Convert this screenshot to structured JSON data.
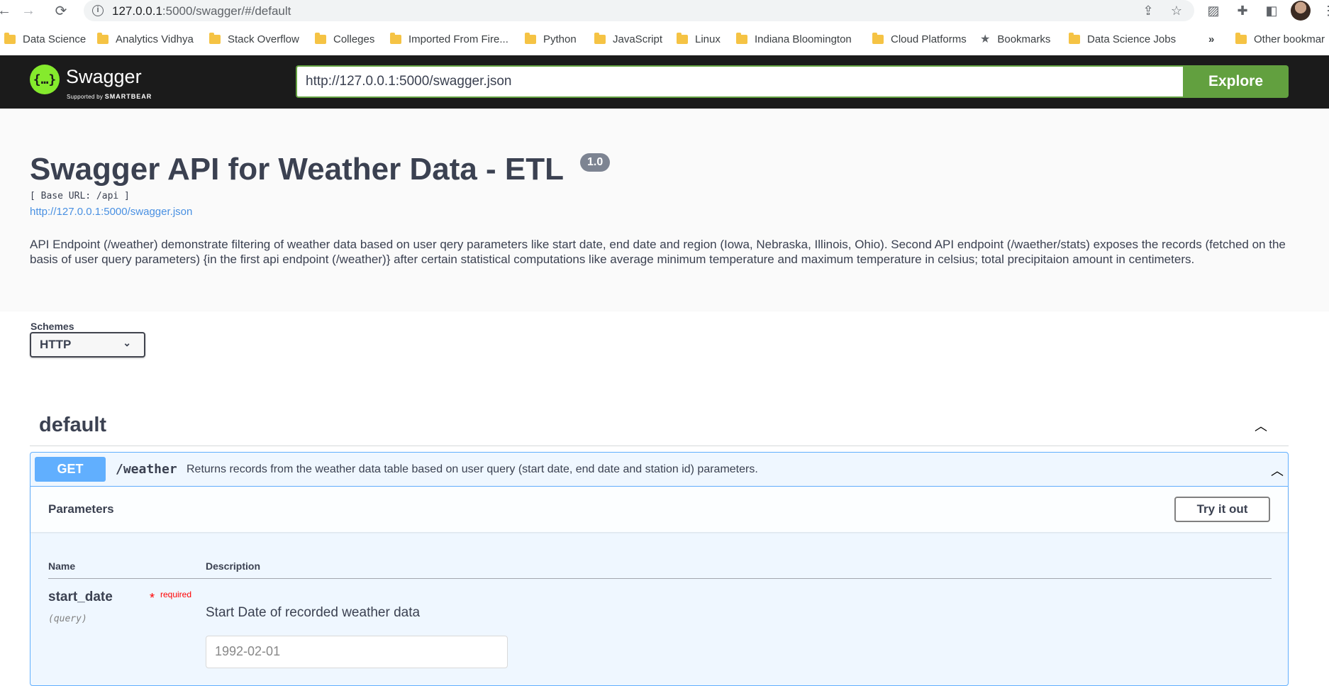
{
  "browser": {
    "url_host": "127.0.0.1",
    "url_rest": ":5000/swagger/#/default",
    "bookmarks": [
      {
        "label": "Data Science",
        "icon": "folder-icon"
      },
      {
        "label": "Analytics Vidhya",
        "icon": "folder-icon"
      },
      {
        "label": "Stack Overflow",
        "icon": "folder-icon"
      },
      {
        "label": "Colleges",
        "icon": "folder-icon"
      },
      {
        "label": "Imported From Fire...",
        "icon": "folder-icon"
      },
      {
        "label": "Python",
        "icon": "folder-icon"
      },
      {
        "label": "JavaScript",
        "icon": "folder-icon"
      },
      {
        "label": "Linux",
        "icon": "folder-icon"
      },
      {
        "label": "Indiana Bloomington",
        "icon": "folder-icon"
      },
      {
        "label": "Cloud Platforms",
        "icon": "folder-icon"
      },
      {
        "label": "Bookmarks",
        "icon": "star-icon"
      },
      {
        "label": "Data Science Jobs",
        "icon": "folder-icon"
      }
    ],
    "overflow_label": "»",
    "other_bookmarks": "Other bookmar"
  },
  "topbar": {
    "logo_text": "Swagger",
    "logo_glyph": "{…}",
    "logo_sub_prefix": "Supported by",
    "logo_sub_brand": "SMARTBEAR",
    "spec_url": "http://127.0.0.1:5000/swagger.json",
    "explore_label": "Explore",
    "accent_color": "#62a03f"
  },
  "info": {
    "title": "Swagger API for Weather Data - ETL",
    "version": "1.0",
    "base_url": "[ Base URL: /api ]",
    "spec_link": "http://127.0.0.1:5000/swagger.json",
    "description": "API Endpoint (/weather) demonstrate filtering of weather data based on user qery parameters like start date, end date and region (Iowa, Nebraska, Illinois, Ohio). Second API endpoint (/waether/stats) exposes the records (fetched on the basis of user query parameters) {in the first api endpoint (/weather)} after certain statistical computations like average minimum temperature and maximum temperature in celsius; total precipitaion amount in centimeters."
  },
  "schemes": {
    "label": "Schemes",
    "selected": "HTTP"
  },
  "ops": {
    "tag": "default",
    "operation": {
      "method": "GET",
      "method_color": "#61affe",
      "path": "/weather",
      "summary": "Returns records from the weather data table based on user query (start date, end date and station id) parameters.",
      "params_title": "Parameters",
      "try_label": "Try it out",
      "col_name": "Name",
      "col_desc": "Description",
      "params": [
        {
          "name": "start_date",
          "required_star": "*",
          "required_label": "required",
          "in": "(query)",
          "description": "Start Date of recorded weather data",
          "placeholder": "1992-02-01"
        }
      ]
    }
  }
}
